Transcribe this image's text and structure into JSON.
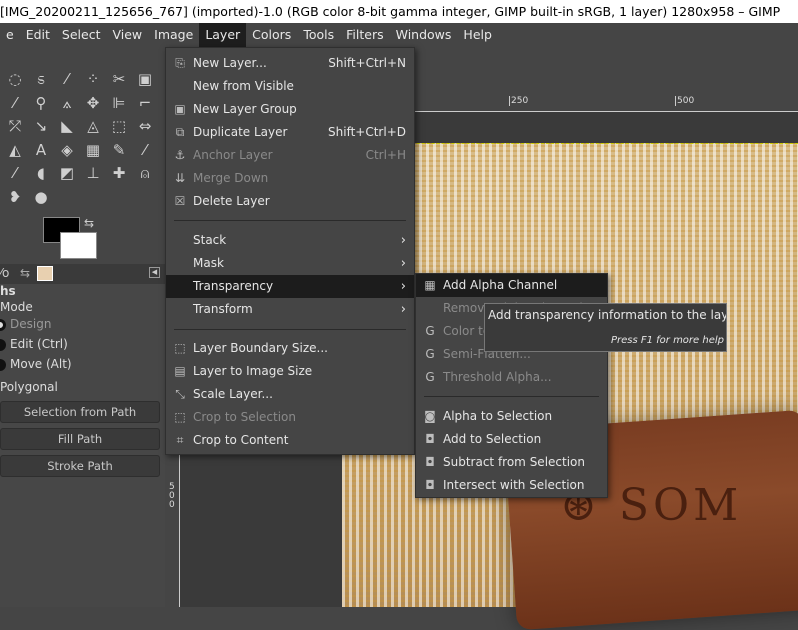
{
  "window": {
    "title": "[IMG_20200211_125656_767] (imported)-1.0 (RGB color 8-bit gamma integer, GIMP built-in sRGB, 1 layer) 1280x958 – GIMP"
  },
  "menubar": [
    "e",
    "Edit",
    "Select",
    "View",
    "Image",
    "Layer",
    "Colors",
    "Tools",
    "Filters",
    "Windows",
    "Help"
  ],
  "layer_menu": [
    {
      "label": "New Layer...",
      "shortcut": "Shift+Ctrl+N",
      "icon": "new-layer-icon",
      "glyph": "⎘"
    },
    {
      "label": "New from Visible",
      "shortcut": "",
      "icon": "",
      "glyph": ""
    },
    {
      "label": "New Layer Group",
      "shortcut": "",
      "icon": "layer-group-icon",
      "glyph": "▣"
    },
    {
      "label": "Duplicate Layer",
      "shortcut": "Shift+Ctrl+D",
      "icon": "duplicate-icon",
      "glyph": "⧉"
    },
    {
      "label": "Anchor Layer",
      "shortcut": "Ctrl+H",
      "icon": "anchor-icon",
      "glyph": "⚓",
      "disabled": true
    },
    {
      "label": "Merge Down",
      "shortcut": "",
      "icon": "merge-down-icon",
      "glyph": "⇊",
      "disabled": true
    },
    {
      "label": "Delete Layer",
      "shortcut": "",
      "icon": "delete-icon",
      "glyph": "☒"
    },
    {
      "label": "Stack",
      "submenu": true
    },
    {
      "label": "Mask",
      "submenu": true
    },
    {
      "label": "Transparency",
      "submenu": true,
      "highlighted": true
    },
    {
      "label": "Transform",
      "submenu": true
    },
    {
      "label": "Layer Boundary Size...",
      "icon": "boundary-icon",
      "glyph": "⬚"
    },
    {
      "label": "Layer to Image Size",
      "icon": "layer-to-image-icon",
      "glyph": "▤"
    },
    {
      "label": "Scale Layer...",
      "icon": "scale-icon",
      "glyph": "⤡"
    },
    {
      "label": "Crop to Selection",
      "icon": "crop-selection-icon",
      "glyph": "⬚",
      "disabled": true
    },
    {
      "label": "Crop to Content",
      "icon": "crop-content-icon",
      "glyph": "⌗"
    }
  ],
  "transparency_menu": [
    {
      "label": "Add Alpha Channel",
      "icon": "checkerboard-icon",
      "glyph": "▦",
      "highlighted": true
    },
    {
      "label": "Remove Alpha Channel",
      "icon": "",
      "glyph": "",
      "disabled": true
    },
    {
      "label": "Color to Alpha...",
      "icon": "gegl-icon",
      "glyph": "G",
      "disabled": true
    },
    {
      "label": "Semi-Flatten...",
      "icon": "gegl-icon",
      "glyph": "G",
      "disabled": true
    },
    {
      "label": "Threshold Alpha...",
      "icon": "gegl-icon",
      "glyph": "G",
      "disabled": true
    },
    {
      "label": "Alpha to Selection",
      "icon": "alpha-selection-icon",
      "glyph": "◙"
    },
    {
      "label": "Add to Selection",
      "icon": "add-selection-icon",
      "glyph": "◘"
    },
    {
      "label": "Subtract from Selection",
      "icon": "subtract-selection-icon",
      "glyph": "◘"
    },
    {
      "label": "Intersect with Selection",
      "icon": "intersect-selection-icon",
      "glyph": "◘"
    }
  ],
  "tooltip": {
    "text": "Add transparency information to the layer",
    "help": "Press F1 for more help"
  },
  "ruler": {
    "h_labels": [
      "250",
      "500"
    ],
    "v_label": "500"
  },
  "tool_options": {
    "title": "hs",
    "mode_label": "Mode",
    "modes": [
      "Design",
      "Edit (Ctrl)",
      "Move (Alt)"
    ],
    "polygonal": "Polygonal",
    "buttons": [
      "Selection from Path",
      "Fill Path",
      "Stroke Path"
    ]
  },
  "colors": {
    "foreground": "#000000",
    "background": "#ffffff",
    "menu_bg": "#454545",
    "highlight": "#1c1c1c"
  }
}
